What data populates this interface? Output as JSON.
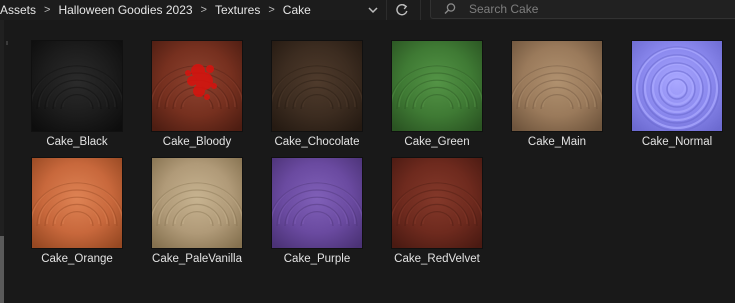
{
  "breadcrumb": {
    "items": [
      "Assets",
      "Halloween Goodies 2023",
      "Textures",
      "Cake"
    ],
    "separator": ">"
  },
  "search": {
    "placeholder": "Search Cake",
    "value": ""
  },
  "textures": [
    {
      "name": "Cake_Black",
      "base": "#1c1c1c",
      "dark": "#0d0d0d",
      "light": "#2b2b2b"
    },
    {
      "name": "Cake_Bloody",
      "base": "#76301f",
      "dark": "#4d1d12",
      "light": "#8d4330"
    },
    {
      "name": "Cake_Chocolate",
      "base": "#3c2c20",
      "dark": "#251a12",
      "light": "#4f3b2c"
    },
    {
      "name": "Cake_Green",
      "base": "#3f7a34",
      "dark": "#2a5422",
      "light": "#549446"
    },
    {
      "name": "Cake_Main",
      "base": "#9a7a5b",
      "dark": "#6f553d",
      "light": "#b0916f"
    },
    {
      "name": "Cake_Normal",
      "base": "#8a88ee",
      "dark": "#6c6ad0",
      "light": "#aaa8ff"
    },
    {
      "name": "Cake_Orange",
      "base": "#c8683c",
      "dark": "#964822",
      "light": "#de8354"
    },
    {
      "name": "Cake_PaleVanilla",
      "base": "#b09a78",
      "dark": "#85714f",
      "light": "#c7b390"
    },
    {
      "name": "Cake_Purple",
      "base": "#6a4aa0",
      "dark": "#4b3276",
      "light": "#8060b8"
    },
    {
      "name": "Cake_RedVelvet",
      "base": "#6e2a1e",
      "dark": "#4a1a12",
      "light": "#84392a"
    }
  ],
  "accents": {
    "blood": "#d4140f"
  },
  "icons": [
    "chevron-down-icon",
    "refresh-icon",
    "search-icon"
  ]
}
